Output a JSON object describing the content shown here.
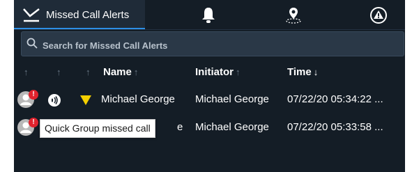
{
  "tabs": [
    {
      "label": "Missed Call Alerts",
      "icon": "missed-call-check-icon",
      "active": true
    },
    {
      "label": "",
      "icon": "bell-icon"
    },
    {
      "label": "",
      "icon": "location-pin-icon"
    },
    {
      "label": "",
      "icon": "emergency-alert-icon"
    }
  ],
  "search": {
    "placeholder": "Search for Missed Call Alerts"
  },
  "columns": {
    "name": "Name",
    "initiator": "Initiator",
    "time": "Time",
    "sort_arrow_up": "↑",
    "sort_arrow_down": "↓"
  },
  "rows": [
    {
      "badge": "!",
      "name": "Michael George",
      "initiator": "Michael George",
      "time": "07/22/20 05:34:22 ..."
    },
    {
      "badge": "!",
      "name": "e",
      "initiator": "Michael George",
      "time": "07/22/20 05:33:58 ..."
    }
  ],
  "tooltip": {
    "text": "Quick Group missed call"
  },
  "colors": {
    "background": "#141d26",
    "accent": "#2d8fe6",
    "badge": "#e0232e",
    "triangle": "#f5d000"
  }
}
